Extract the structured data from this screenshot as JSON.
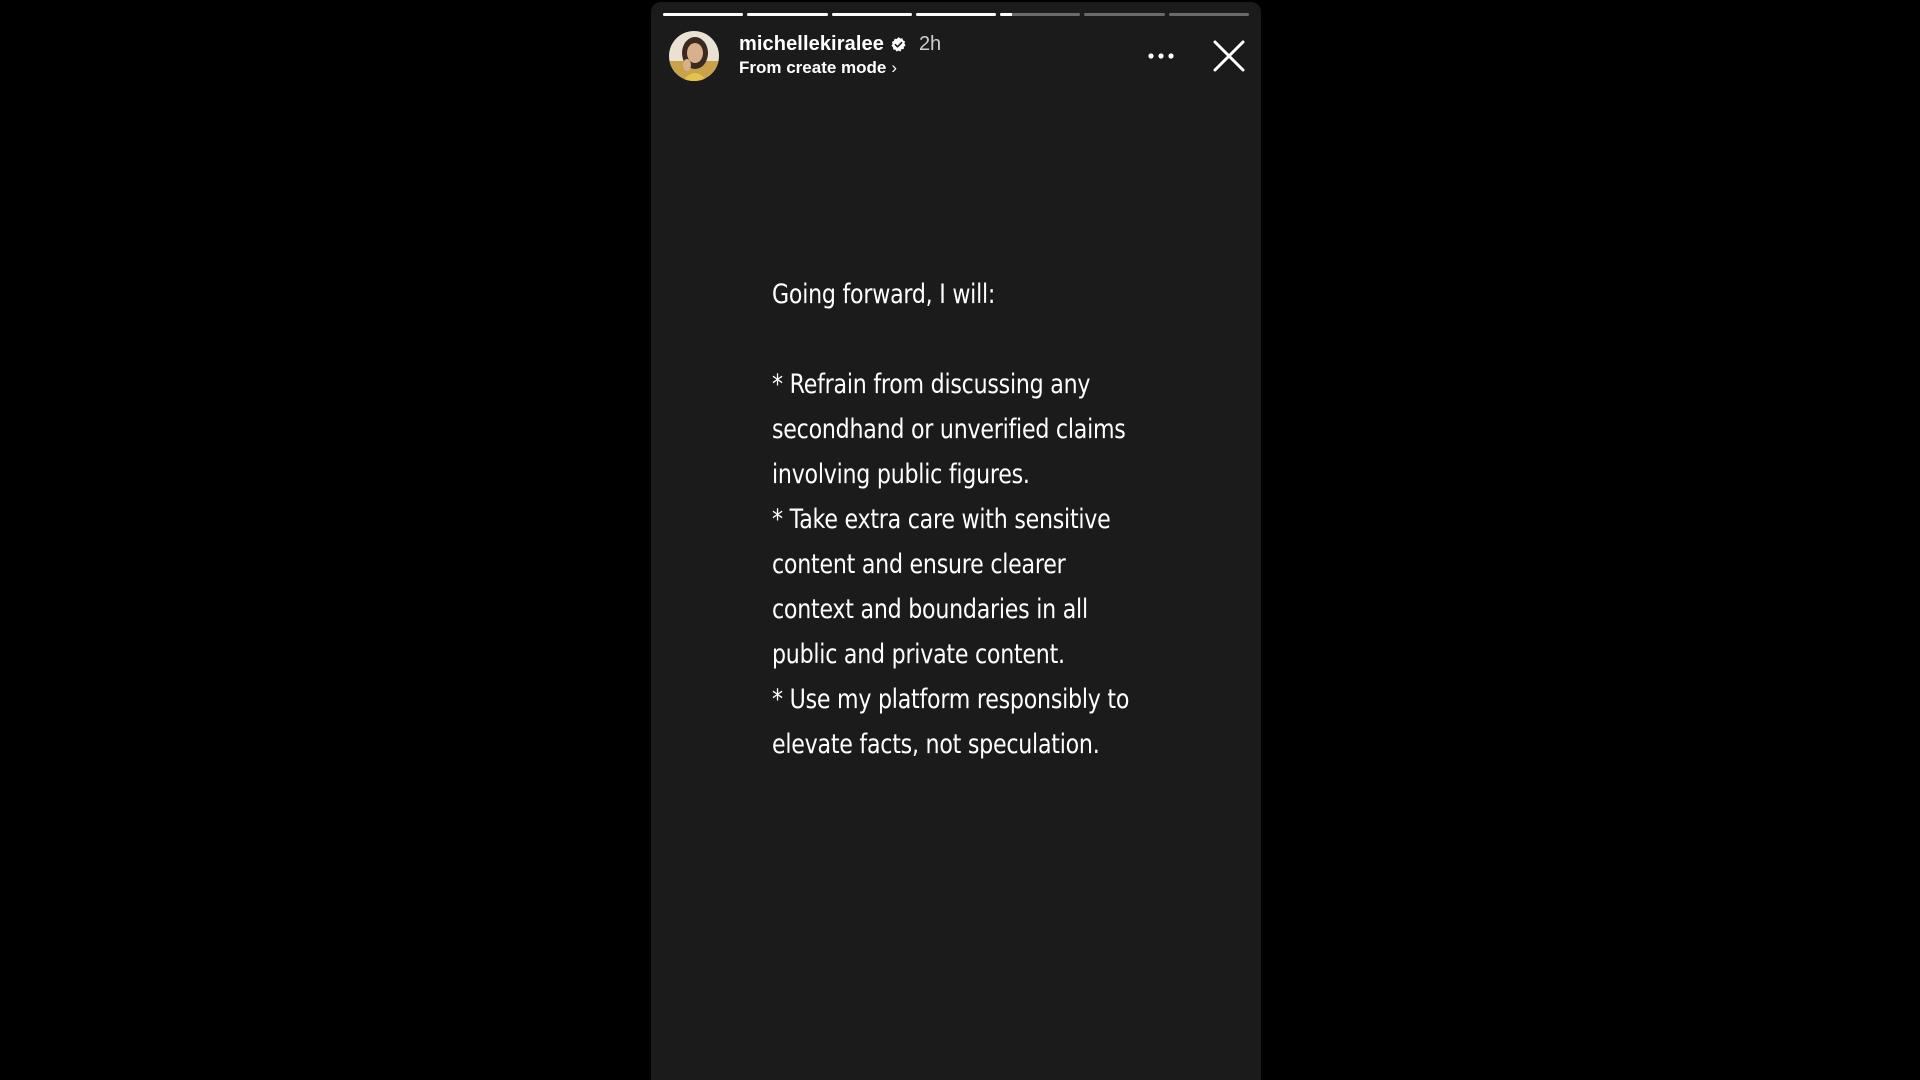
{
  "story": {
    "progress_segments": [
      1,
      1,
      1,
      1,
      0.15,
      0,
      0
    ],
    "header": {
      "username": "michellekiralee",
      "verified": true,
      "time_ago": "2h",
      "subtitle": "From create mode",
      "subtitle_chevron": "›"
    },
    "icons": {
      "verified": "verified-badge-icon",
      "more": "more-options-icon",
      "close": "close-icon"
    },
    "text": {
      "intro": "Going forward, I will:",
      "lines": [
        "* Refrain from discussing any",
        "secondhand or unverified claims",
        "involving public figures.",
        "* Take extra care with sensitive",
        "content and ensure clearer",
        "context and boundaries in all",
        "public and private content.",
        "* Use my platform responsibly to",
        "elevate facts, not speculation."
      ]
    },
    "colors": {
      "page_background": "#000000",
      "story_background": "#1b1b1b",
      "text": "#ffffff",
      "verified_badge": "#ffffff"
    }
  }
}
